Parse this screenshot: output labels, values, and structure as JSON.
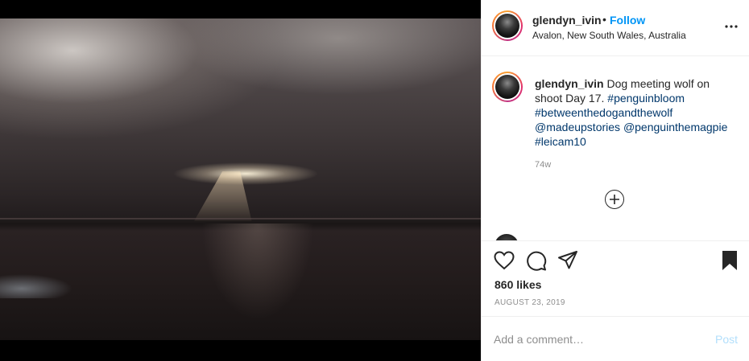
{
  "post": {
    "username": "glendyn_ivin",
    "separator": "•",
    "follow_label": "Follow",
    "location": "Avalon, New South Wales, Australia",
    "more_label": "•••"
  },
  "caption": {
    "username": "glendyn_ivin",
    "text": "Dog meeting wolf on shoot Day 17.",
    "tags": [
      "#penguinbloom",
      "#betweenthedogandthewolf",
      "@madeupstories",
      "@penguinthemagpie",
      "#leicam10"
    ],
    "age": "74w"
  },
  "engagement": {
    "likes": "860 likes",
    "date": "AUGUST 23, 2019"
  },
  "comment_box": {
    "placeholder": "Add a comment…",
    "post_label": "Post"
  },
  "icons": {
    "like": "heart-icon",
    "comment": "comment-bubble-icon",
    "share": "paper-plane-icon",
    "save": "bookmark-icon",
    "load_more": "plus-circle-icon"
  },
  "colors": {
    "link": "#00376b",
    "follow": "#0095f6",
    "post_disabled": "#b2dffc",
    "muted": "#8e8e8e"
  }
}
